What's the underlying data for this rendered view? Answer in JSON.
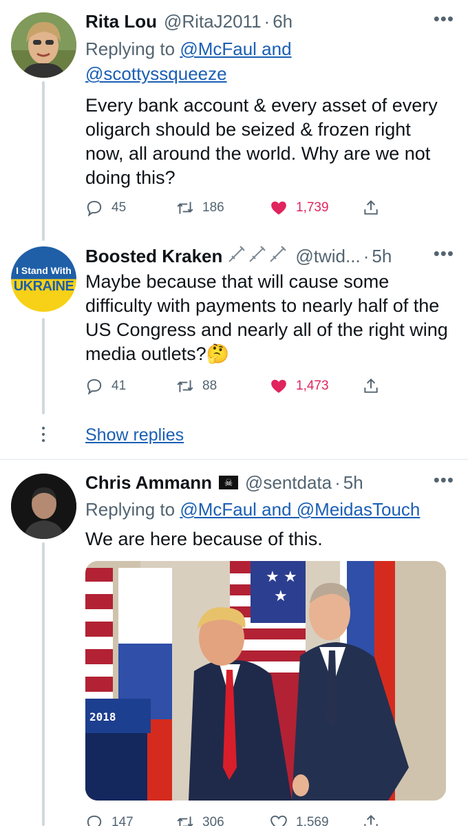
{
  "tweets": [
    {
      "name": "Rita Lou",
      "handle": "@RitaJ2011",
      "time": "6h",
      "replying_prefix": "Replying to ",
      "replying_to_line1": "@McFaul and",
      "replying_to_line2": "@scottyssqueeze",
      "text": "Every bank account & every asset of every oligarch should be seized & frozen right now, all around the world. Why are we not doing this?",
      "replies": "45",
      "retweets": "186",
      "likes": "1,739"
    },
    {
      "name": "Boosted Kraken",
      "handle": "@twid...",
      "time": "5h",
      "avatar_line1": "I Stand With",
      "avatar_line2": "UKRAINE",
      "text": "Maybe because that will cause some difficulty with  payments to nearly half of the US Congress and nearly all of the right wing media outlets?🤔",
      "replies": "41",
      "retweets": "88",
      "likes": "1,473"
    },
    {
      "name": "Chris Ammann",
      "handle": "@sentdata",
      "time": "5h",
      "replying_prefix": "Replying to ",
      "replying_to_line1": "@McFaul and @MeidasTouch",
      "text": "We are here because of this.",
      "photo_podium_label": "2018",
      "replies": "147",
      "retweets": "306",
      "likes": "1,569"
    }
  ],
  "show_replies": "Show replies",
  "colors": {
    "like": "#e0245e",
    "link": "#1a5fb4",
    "muted": "#536471",
    "ukraine_blue": "#1f5fa8",
    "ukraine_yellow": "#f7d117"
  },
  "icons": [
    "more-icon",
    "reply-icon",
    "retweet-icon",
    "like-icon",
    "share-icon",
    "syringe-icon",
    "pirate-flag-icon"
  ]
}
